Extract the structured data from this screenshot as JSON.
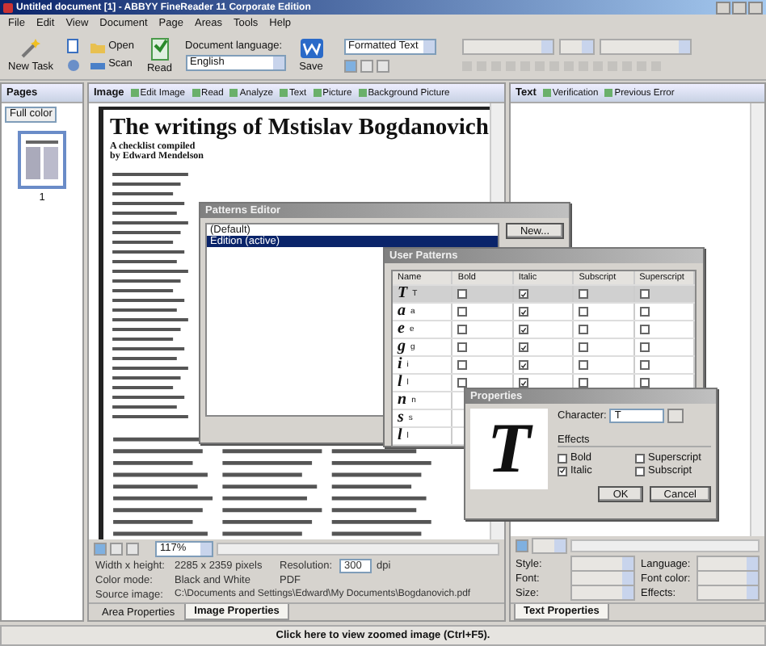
{
  "window": {
    "title": "Untitled document [1] - ABBYY FineReader 11 Corporate Edition"
  },
  "menu": [
    "File",
    "Edit",
    "View",
    "Document",
    "Page",
    "Areas",
    "Tools",
    "Help"
  ],
  "toolbar": {
    "new_task": "New Task",
    "open": "Open",
    "scan": "Scan",
    "read": "Read",
    "language_label": "Document language:",
    "language": "English",
    "save": "Save",
    "format": "Formatted Text"
  },
  "pages_pane": {
    "title": "Pages",
    "color_mode": "Full color",
    "pages": [
      {
        "number": "1",
        "selected": true
      }
    ]
  },
  "image_pane": {
    "title": "Image",
    "tools": [
      "Edit Image",
      "Read",
      "Analyze",
      "Text",
      "Picture",
      "Background Picture"
    ],
    "heading": "The writings of Mstislav Bogdanovich",
    "subheading": "A checklist compiled",
    "byline": "by Edward Mendelson",
    "zoom": "117%"
  },
  "image_properties": {
    "size_label": "Width x height:",
    "size": "2285 x 2359 pixels",
    "resolution_label": "Resolution:",
    "resolution": "300",
    "resolution_unit": "dpi",
    "color_label": "Color mode:",
    "color_mode": "Black and White",
    "format": "PDF",
    "source_label": "Source image:",
    "source": "C:\\Documents and Settings\\Edward\\My Documents\\Bogdanovich.pdf"
  },
  "properties_tabs": [
    {
      "label": "Area Properties",
      "selected": false
    },
    {
      "label": "Image Properties",
      "selected": true
    }
  ],
  "text_pane": {
    "title": "Text",
    "tools": [
      "Verification",
      "Previous Error"
    ],
    "fields": [
      "Style:",
      "Language:",
      "Font:",
      "Font color:",
      "Size:",
      "Effects:"
    ],
    "tabs": [
      {
        "label": "Text Properties",
        "selected": true
      }
    ]
  },
  "patterns_editor": {
    "title": "Patterns Editor",
    "patterns": [
      {
        "label": "(Default)",
        "selected": false
      },
      {
        "label": "Edition (active)",
        "selected": true
      }
    ],
    "new_button": "New..."
  },
  "user_patterns": {
    "title": "User Patterns",
    "columns": [
      "Name",
      "Bold",
      "Italic",
      "Subscript",
      "Superscript"
    ],
    "rows": [
      {
        "glyph": "T",
        "char": "T",
        "selected": true,
        "bold": false,
        "italic": true,
        "subscript": false,
        "superscript": false
      },
      {
        "glyph": "a",
        "char": "a",
        "selected": false,
        "bold": false,
        "italic": true,
        "subscript": false,
        "superscript": false
      },
      {
        "glyph": "e",
        "char": "e",
        "selected": false,
        "bold": false,
        "italic": true,
        "subscript": false,
        "superscript": false
      },
      {
        "glyph": "g",
        "char": "g",
        "selected": false,
        "bold": false,
        "italic": true,
        "subscript": false,
        "superscript": false
      },
      {
        "glyph": "i",
        "char": "i",
        "selected": false,
        "bold": false,
        "italic": true,
        "subscript": false,
        "superscript": false
      },
      {
        "glyph": "l",
        "char": "l",
        "selected": false,
        "bold": false,
        "italic": true,
        "subscript": false,
        "superscript": false
      },
      {
        "glyph": "n",
        "char": "n",
        "selected": false
      },
      {
        "glyph": "s",
        "char": "s",
        "selected": false
      },
      {
        "glyph": "l",
        "char": "l",
        "selected": false
      }
    ]
  },
  "properties_dialog": {
    "title": "Properties",
    "glyph": "T",
    "character_label": "Character:",
    "character": "T",
    "effects_label": "Effects",
    "effects": [
      {
        "label": "Bold",
        "checked": false
      },
      {
        "label": "Superscript",
        "checked": false
      },
      {
        "label": "Italic",
        "checked": true
      },
      {
        "label": "Subscript",
        "checked": false
      }
    ],
    "buttons": [
      "OK",
      "Cancel"
    ]
  },
  "status_bar": "Click here to view zoomed image (Ctrl+F5)."
}
